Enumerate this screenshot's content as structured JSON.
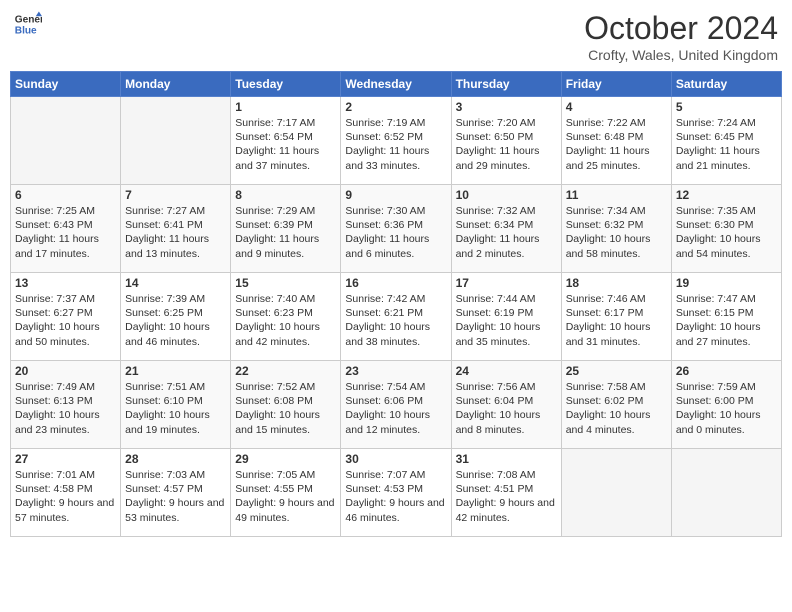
{
  "header": {
    "logo_line1": "General",
    "logo_line2": "Blue",
    "month": "October 2024",
    "location": "Crofty, Wales, United Kingdom"
  },
  "days_of_week": [
    "Sunday",
    "Monday",
    "Tuesday",
    "Wednesday",
    "Thursday",
    "Friday",
    "Saturday"
  ],
  "weeks": [
    [
      {
        "day": "",
        "info": ""
      },
      {
        "day": "",
        "info": ""
      },
      {
        "day": "1",
        "info": "Sunrise: 7:17 AM\nSunset: 6:54 PM\nDaylight: 11 hours and 37 minutes."
      },
      {
        "day": "2",
        "info": "Sunrise: 7:19 AM\nSunset: 6:52 PM\nDaylight: 11 hours and 33 minutes."
      },
      {
        "day": "3",
        "info": "Sunrise: 7:20 AM\nSunset: 6:50 PM\nDaylight: 11 hours and 29 minutes."
      },
      {
        "day": "4",
        "info": "Sunrise: 7:22 AM\nSunset: 6:48 PM\nDaylight: 11 hours and 25 minutes."
      },
      {
        "day": "5",
        "info": "Sunrise: 7:24 AM\nSunset: 6:45 PM\nDaylight: 11 hours and 21 minutes."
      }
    ],
    [
      {
        "day": "6",
        "info": "Sunrise: 7:25 AM\nSunset: 6:43 PM\nDaylight: 11 hours and 17 minutes."
      },
      {
        "day": "7",
        "info": "Sunrise: 7:27 AM\nSunset: 6:41 PM\nDaylight: 11 hours and 13 minutes."
      },
      {
        "day": "8",
        "info": "Sunrise: 7:29 AM\nSunset: 6:39 PM\nDaylight: 11 hours and 9 minutes."
      },
      {
        "day": "9",
        "info": "Sunrise: 7:30 AM\nSunset: 6:36 PM\nDaylight: 11 hours and 6 minutes."
      },
      {
        "day": "10",
        "info": "Sunrise: 7:32 AM\nSunset: 6:34 PM\nDaylight: 11 hours and 2 minutes."
      },
      {
        "day": "11",
        "info": "Sunrise: 7:34 AM\nSunset: 6:32 PM\nDaylight: 10 hours and 58 minutes."
      },
      {
        "day": "12",
        "info": "Sunrise: 7:35 AM\nSunset: 6:30 PM\nDaylight: 10 hours and 54 minutes."
      }
    ],
    [
      {
        "day": "13",
        "info": "Sunrise: 7:37 AM\nSunset: 6:27 PM\nDaylight: 10 hours and 50 minutes."
      },
      {
        "day": "14",
        "info": "Sunrise: 7:39 AM\nSunset: 6:25 PM\nDaylight: 10 hours and 46 minutes."
      },
      {
        "day": "15",
        "info": "Sunrise: 7:40 AM\nSunset: 6:23 PM\nDaylight: 10 hours and 42 minutes."
      },
      {
        "day": "16",
        "info": "Sunrise: 7:42 AM\nSunset: 6:21 PM\nDaylight: 10 hours and 38 minutes."
      },
      {
        "day": "17",
        "info": "Sunrise: 7:44 AM\nSunset: 6:19 PM\nDaylight: 10 hours and 35 minutes."
      },
      {
        "day": "18",
        "info": "Sunrise: 7:46 AM\nSunset: 6:17 PM\nDaylight: 10 hours and 31 minutes."
      },
      {
        "day": "19",
        "info": "Sunrise: 7:47 AM\nSunset: 6:15 PM\nDaylight: 10 hours and 27 minutes."
      }
    ],
    [
      {
        "day": "20",
        "info": "Sunrise: 7:49 AM\nSunset: 6:13 PM\nDaylight: 10 hours and 23 minutes."
      },
      {
        "day": "21",
        "info": "Sunrise: 7:51 AM\nSunset: 6:10 PM\nDaylight: 10 hours and 19 minutes."
      },
      {
        "day": "22",
        "info": "Sunrise: 7:52 AM\nSunset: 6:08 PM\nDaylight: 10 hours and 15 minutes."
      },
      {
        "day": "23",
        "info": "Sunrise: 7:54 AM\nSunset: 6:06 PM\nDaylight: 10 hours and 12 minutes."
      },
      {
        "day": "24",
        "info": "Sunrise: 7:56 AM\nSunset: 6:04 PM\nDaylight: 10 hours and 8 minutes."
      },
      {
        "day": "25",
        "info": "Sunrise: 7:58 AM\nSunset: 6:02 PM\nDaylight: 10 hours and 4 minutes."
      },
      {
        "day": "26",
        "info": "Sunrise: 7:59 AM\nSunset: 6:00 PM\nDaylight: 10 hours and 0 minutes."
      }
    ],
    [
      {
        "day": "27",
        "info": "Sunrise: 7:01 AM\nSunset: 4:58 PM\nDaylight: 9 hours and 57 minutes."
      },
      {
        "day": "28",
        "info": "Sunrise: 7:03 AM\nSunset: 4:57 PM\nDaylight: 9 hours and 53 minutes."
      },
      {
        "day": "29",
        "info": "Sunrise: 7:05 AM\nSunset: 4:55 PM\nDaylight: 9 hours and 49 minutes."
      },
      {
        "day": "30",
        "info": "Sunrise: 7:07 AM\nSunset: 4:53 PM\nDaylight: 9 hours and 46 minutes."
      },
      {
        "day": "31",
        "info": "Sunrise: 7:08 AM\nSunset: 4:51 PM\nDaylight: 9 hours and 42 minutes."
      },
      {
        "day": "",
        "info": ""
      },
      {
        "day": "",
        "info": ""
      }
    ]
  ]
}
